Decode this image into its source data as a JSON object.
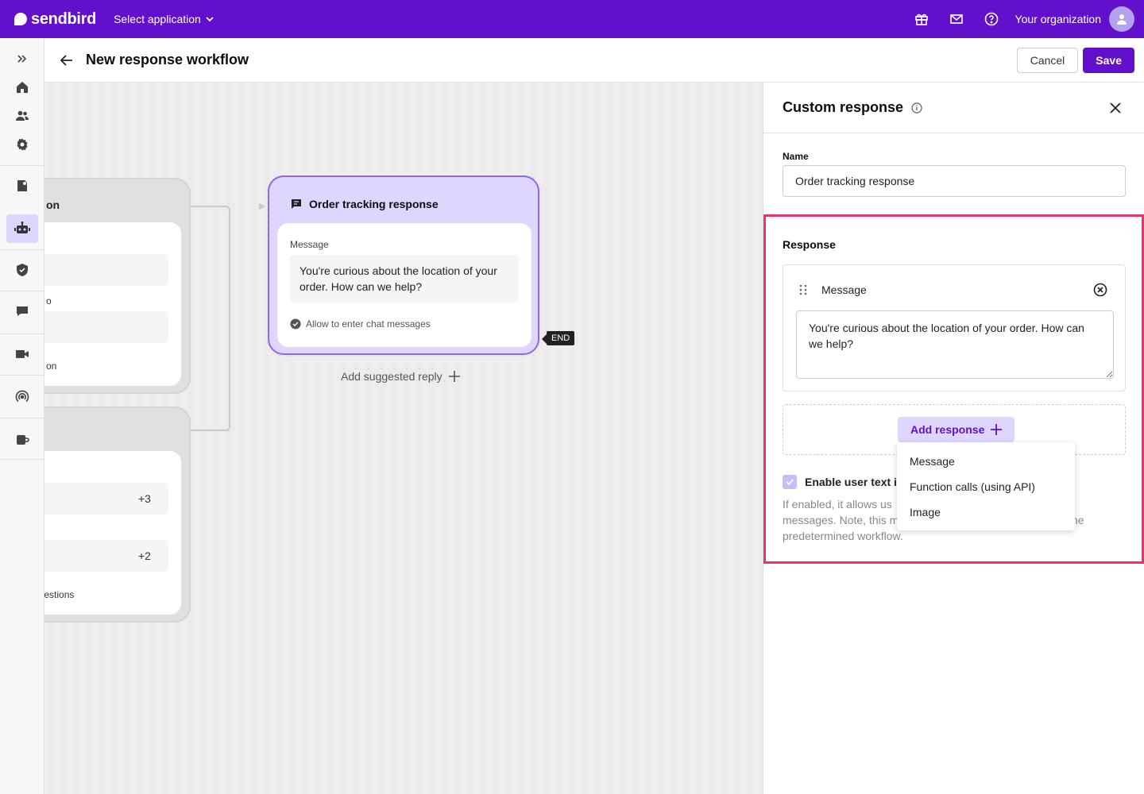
{
  "topbar": {
    "logo_text": "sendbird",
    "app_select": "Select application",
    "org_name": "Your organization",
    "icons": [
      "gift-icon",
      "mail-icon",
      "help-icon",
      "user-avatar-icon"
    ]
  },
  "rail": {
    "items": [
      "expand-icon",
      "home-icon",
      "users-icon",
      "settings-icon",
      "chat-doc-icon",
      "bot-icon",
      "shield-icon",
      "chat-bubble-icon",
      "video-icon",
      "broadcast-icon",
      "desk-icon"
    ],
    "active": "bot-icon"
  },
  "header": {
    "title": "New response workflow",
    "cancel_label": "Cancel",
    "save_label": "Save"
  },
  "canvas": {
    "left_node_1": {
      "title_fragment": "on",
      "line_fragment": "o",
      "footer_fragment": "on"
    },
    "left_node_2": {
      "row1_fragment": "?",
      "row1_count": "+3",
      "row2_count": "+2",
      "footer_fragment": "ar questions"
    },
    "response_node": {
      "title": "Order tracking response",
      "message_label": "Message",
      "message_text": "You're curious about the location of your order. How can we help?",
      "allow_text": "Allow to enter chat messages"
    },
    "end_badge": "END",
    "add_suggested_reply": "Add suggested reply"
  },
  "panel": {
    "title": "Custom response",
    "name_label": "Name",
    "name_value": "Order tracking response",
    "response_label": "Response",
    "message_card_title": "Message",
    "message_text": "You're curious about the location of your order. How can we help?",
    "add_response_label": "Add response",
    "enable_label": "Enable user text i",
    "enable_desc_lines": [
      "If enabled, it allows us",
      "messages. Note, this m",
      "predetermined workflow."
    ],
    "enable_desc_tail": "he"
  },
  "dropdown": {
    "items": [
      "Message",
      "Function calls (using API)",
      "Image"
    ]
  },
  "colors": {
    "brand": "#6210cc",
    "accent_light": "#ded6ff",
    "node_border": "#8b68f0",
    "highlight": "#e8336b"
  }
}
